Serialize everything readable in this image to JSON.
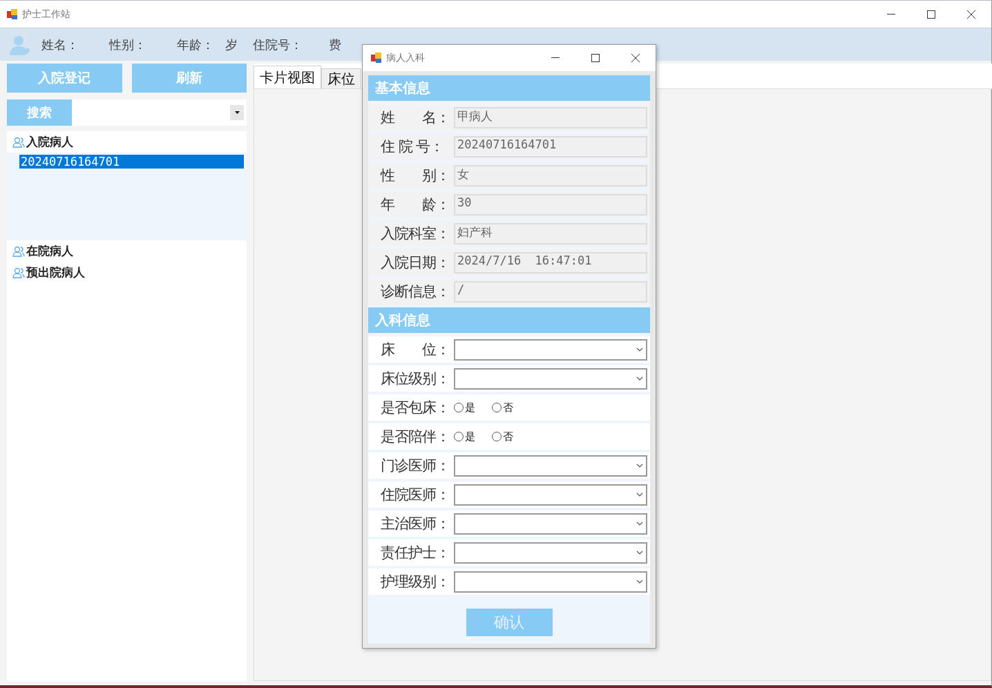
{
  "window": {
    "title": "护士工作站"
  },
  "header": {
    "fields": [
      "姓名：",
      "性别：",
      "年龄：",
      "岁",
      "住院号：",
      "费"
    ]
  },
  "sidebar": {
    "buttons": [
      "入院登记",
      "刷新"
    ],
    "search": {
      "label": "搜索"
    },
    "tree": [
      {
        "label": "入院病人",
        "expanded": true,
        "children": [
          {
            "label": "20240716164701",
            "selected": true
          }
        ]
      },
      {
        "label": "在院病人",
        "expanded": false
      },
      {
        "label": "预出院病人",
        "expanded": false
      }
    ]
  },
  "tabs": [
    {
      "label": "卡片视图",
      "selected": true
    },
    {
      "label": "床位",
      "selected": false
    }
  ],
  "dialog": {
    "title": "病人入科",
    "sections": [
      {
        "title": "基本信息",
        "rows": [
          {
            "kind": "text",
            "label": "姓　　名：",
            "value": "甲病人"
          },
          {
            "kind": "text",
            "label": "住 院 号：",
            "value": "20240716164701"
          },
          {
            "kind": "text",
            "label": "性　　别：",
            "value": "女"
          },
          {
            "kind": "text",
            "label": "年　　龄：",
            "value": "30"
          },
          {
            "kind": "text",
            "label": "入院科室：",
            "value": "妇产科"
          },
          {
            "kind": "text",
            "label": "入院日期：",
            "value": "2024/7/16  16:47:01"
          },
          {
            "kind": "text",
            "label": "诊断信息：",
            "value": "/"
          }
        ]
      },
      {
        "title": "入科信息",
        "rows": [
          {
            "kind": "select",
            "label": "床　　位："
          },
          {
            "kind": "select",
            "label": "床位级别："
          },
          {
            "kind": "radio",
            "label": "是否包床：",
            "options": [
              {
                "label": "是",
                "selected": false
              },
              {
                "label": "否",
                "selected": false
              }
            ]
          },
          {
            "kind": "radio",
            "label": "是否陪伴：",
            "options": [
              {
                "label": "是",
                "selected": false
              },
              {
                "label": "否",
                "selected": false
              }
            ]
          },
          {
            "kind": "select",
            "label": "门诊医师："
          },
          {
            "kind": "select",
            "label": "住院医师："
          },
          {
            "kind": "select",
            "label": "主治医师："
          },
          {
            "kind": "select",
            "label": "责任护士："
          },
          {
            "kind": "select",
            "label": "护理级别："
          }
        ]
      }
    ],
    "confirm": "确认"
  }
}
